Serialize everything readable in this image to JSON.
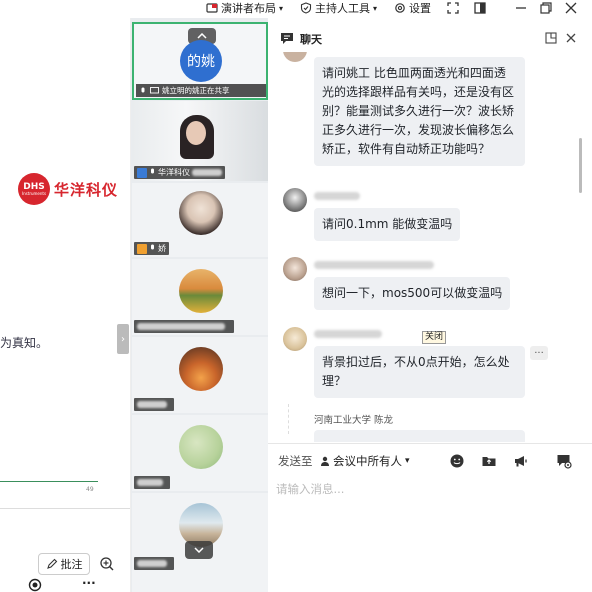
{
  "toolbar": {
    "presenter_layout": "演讲者布局",
    "host_tools": "主持人工具",
    "settings": "设置"
  },
  "slide": {
    "logo_abbr": "DHS",
    "logo_sub": "Instruments",
    "logo_name": "华洋科仪",
    "body_text": "为真知。",
    "page_number": "49",
    "annotate_label": "批注"
  },
  "participants": {
    "presenter_avatar_text": "的姚",
    "sharing_status": "姚立明的姚正在共享",
    "tiles": [
      {
        "name": "华洋科仪"
      },
      {
        "name": "娇"
      }
    ]
  },
  "chat": {
    "title": "聊天",
    "messages": [
      {
        "text": "请问姚工 比色皿两面透光和四面透光的选择跟样品有关吗，还是没有区别？能量测试多久进行一次？波长矫正多久进行一次，发现波长偏移怎么矫正，软件有自动矫正功能吗？"
      },
      {
        "text": "请问0.1mm 能做变温吗"
      },
      {
        "text": "想问一下，mos500可以做变温吗"
      },
      {
        "text": "背景扣过后，不从0点开始，怎么处理？"
      }
    ],
    "tooltip_close": "关闭",
    "more_label": "···",
    "last_sender": "河南工业大学 陈龙",
    "send_to_label": "发送至",
    "recipient": "会议中所有人",
    "input_placeholder": "请输入消息..."
  },
  "colors": {
    "accent_green": "#3cb371",
    "brand_red": "#d7262e",
    "bubble_bg": "#eef0f3"
  }
}
